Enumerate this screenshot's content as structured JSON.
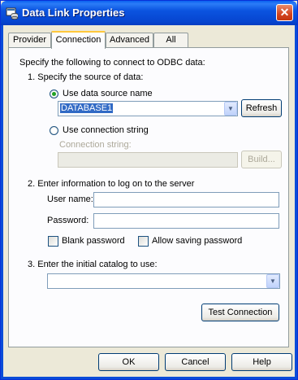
{
  "window": {
    "title": "Data Link Properties",
    "close_glyph": "✕",
    "icon": "database-link-icon"
  },
  "tabs": [
    {
      "label": "Provider",
      "active": false
    },
    {
      "label": "Connection",
      "active": true
    },
    {
      "label": "Advanced",
      "active": false
    },
    {
      "label": "All",
      "active": false
    }
  ],
  "connection": {
    "intro": "Specify the following to connect to ODBC data:",
    "step1": "1. Specify the source of data:",
    "use_dsn": {
      "label": "Use data source name",
      "selected": true
    },
    "dsn_value": "DATABASE1",
    "refresh_label": "Refresh",
    "use_conn_string": {
      "label": "Use connection string",
      "selected": false
    },
    "conn_string_label": "Connection string:",
    "conn_string_value": "",
    "build_label": "Build...",
    "step2": "2. Enter information to log on to the server",
    "username_label": "User name:",
    "username_value": "",
    "password_label": "Password:",
    "password_value": "",
    "blank_password": {
      "label": "Blank password",
      "checked": false
    },
    "allow_saving": {
      "label": "Allow saving password",
      "checked": false
    },
    "step3": "3. Enter the initial catalog to use:",
    "catalog_value": "",
    "test_label": "Test Connection"
  },
  "footer": {
    "ok_label": "OK",
    "cancel_label": "Cancel",
    "help_label": "Help"
  },
  "colors": {
    "title_blue": "#0b54e0",
    "frame": "#ece9d8",
    "selection": "#316ac5",
    "radio_dot": "#21a121"
  }
}
